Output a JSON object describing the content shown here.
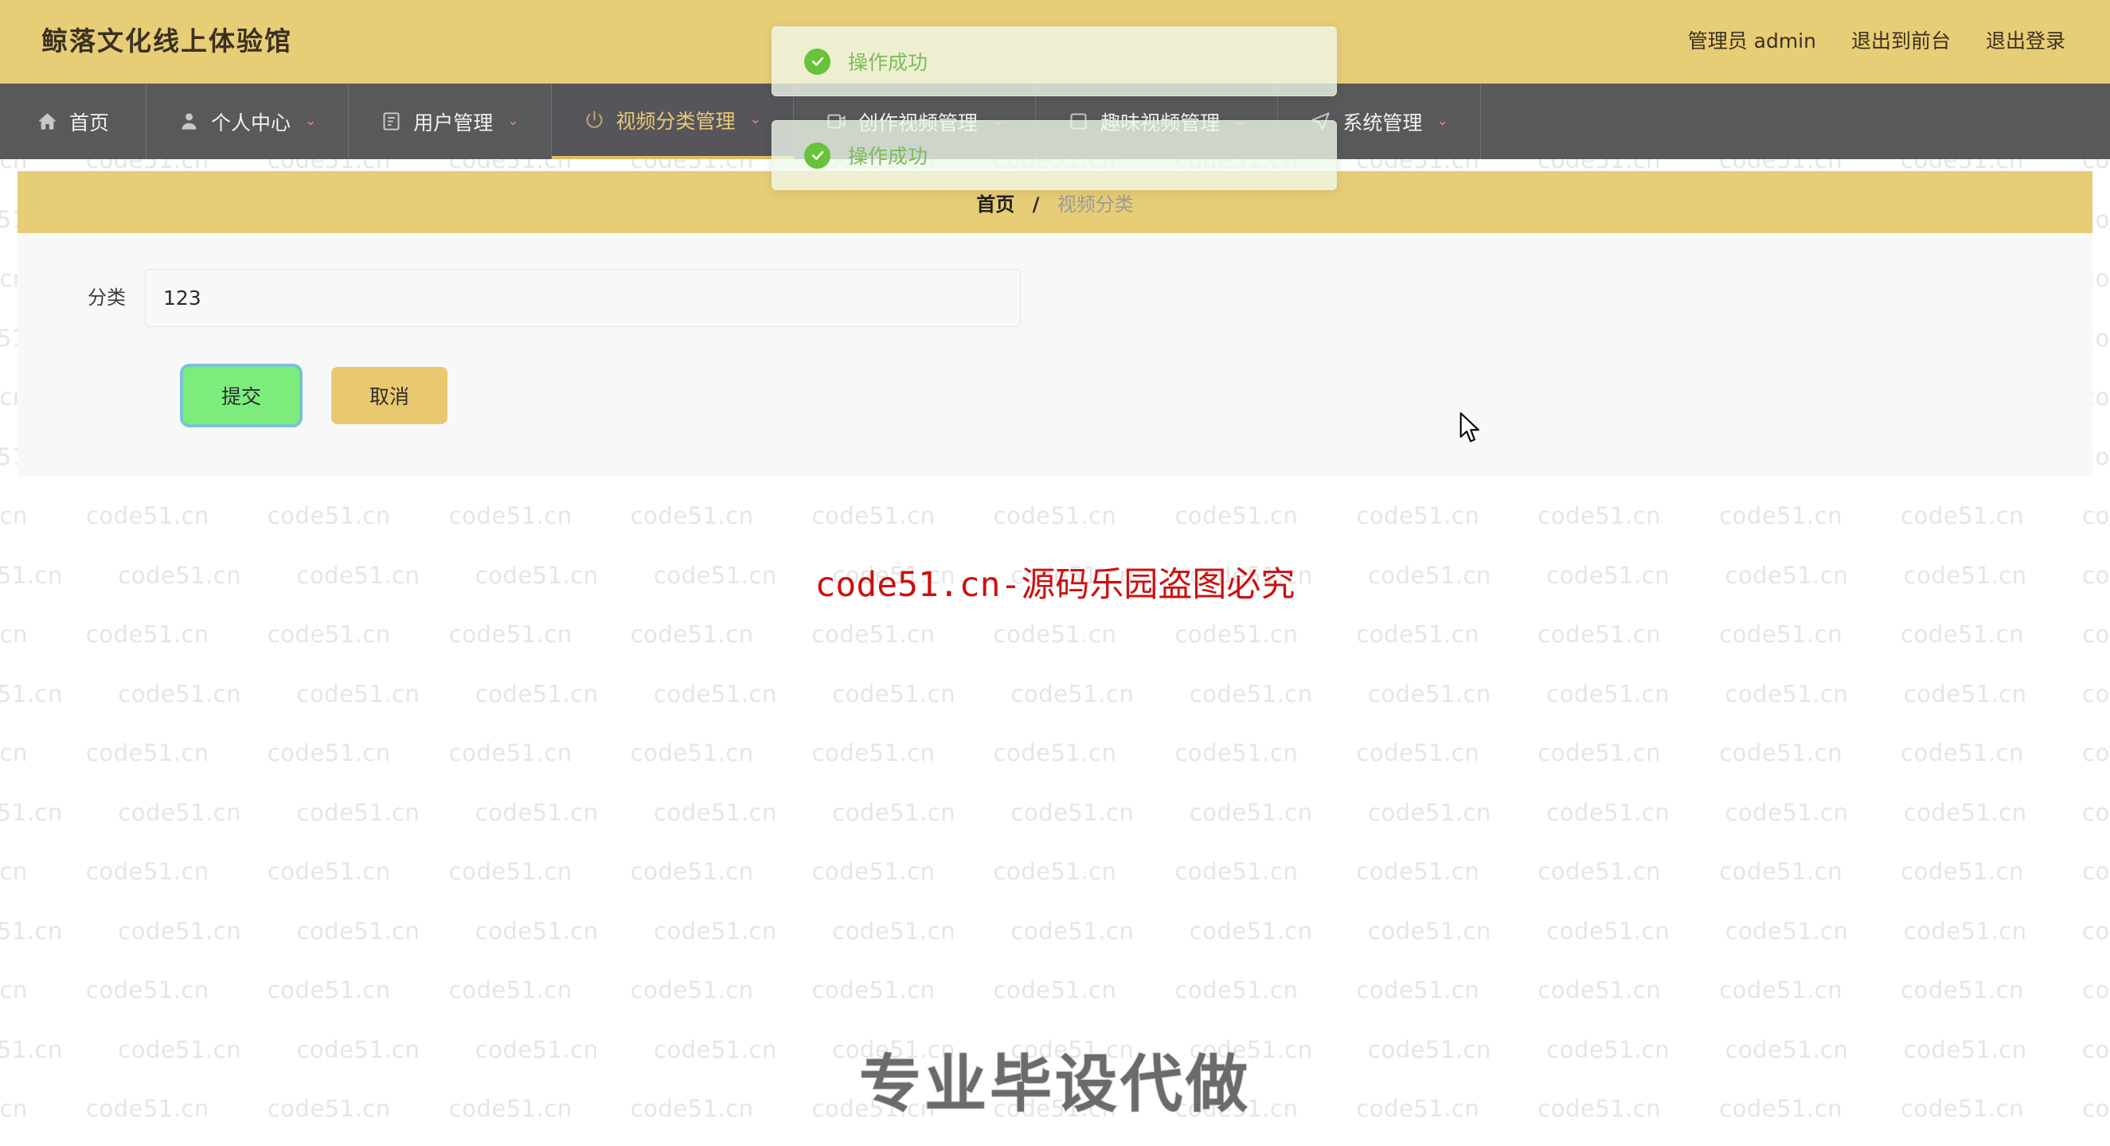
{
  "header": {
    "brand": "鲸落文化线上体验馆",
    "right_links": [
      {
        "label": "管理员 admin",
        "name": "admin-user"
      },
      {
        "label": "退出到前台",
        "name": "back-to-front"
      },
      {
        "label": "退出登录",
        "name": "logout"
      }
    ]
  },
  "nav": {
    "items": [
      {
        "label": "首页",
        "icon": "home-icon",
        "caret": "",
        "active": false
      },
      {
        "label": "个人中心",
        "icon": "user-icon",
        "caret": "⌄",
        "active": false
      },
      {
        "label": "用户管理",
        "icon": "document-icon",
        "caret": "⌄",
        "active": false
      },
      {
        "label": "视频分类管理",
        "icon": "power-icon",
        "caret": "⌄",
        "active": true
      },
      {
        "label": "创作视频管理",
        "icon": "video-icon",
        "caret": "⌄",
        "active": false
      },
      {
        "label": "趣味视频管理",
        "icon": "square-icon",
        "caret": "⌄",
        "active": false
      },
      {
        "label": "系统管理",
        "icon": "send-icon",
        "caret": "⌄",
        "active": false
      }
    ]
  },
  "breadcrumb": {
    "root": "首页",
    "separator": "/",
    "current": "视频分类"
  },
  "form": {
    "label": "分类",
    "value": "123",
    "placeholder": "",
    "submit_label": "提交",
    "cancel_label": "取消"
  },
  "toasts": [
    {
      "message": "操作成功",
      "icon": "check-circle-icon",
      "type": "success"
    },
    {
      "message": "操作成功",
      "icon": "check-circle-icon",
      "type": "success"
    }
  ],
  "watermarks": {
    "tile_text": "code51.cn",
    "red_text": "code51.cn-源码乐园盗图必究",
    "bottom_text": "专业毕设代做"
  },
  "colors": {
    "brand_amber": "#e8cd77",
    "nav_dark": "#59585a",
    "active_gold": "#e6c878",
    "submit_green": "#7ced7c",
    "cancel_amber": "#e9c86f",
    "toast_green": "#68c23a",
    "red_watermark": "#cc1111"
  }
}
